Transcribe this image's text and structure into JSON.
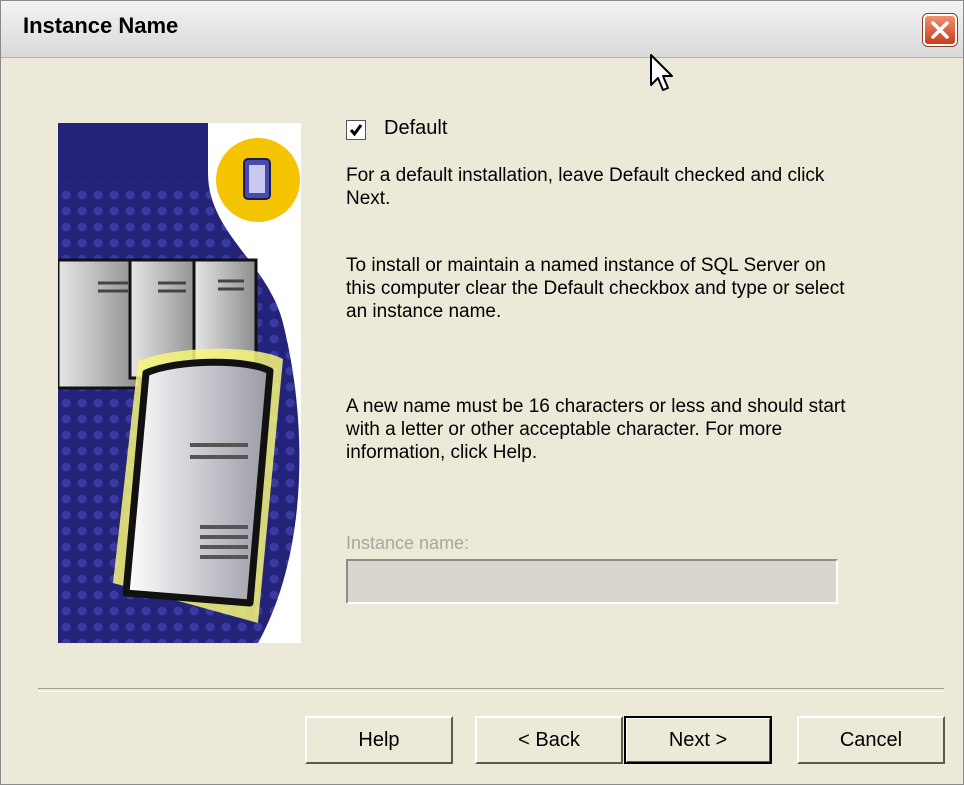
{
  "window": {
    "title": "Instance Name"
  },
  "default_checkbox": {
    "label": "Default",
    "checked": true
  },
  "paragraphs": [
    "For a default installation, leave Default checked and click Next.",
    "To install or maintain a named instance of SQL Server on this computer clear the Default checkbox and type or select an instance name.",
    "A new name must be 16 characters or less and should start with a letter or other acceptable character.  For more information, click Help."
  ],
  "instance_name": {
    "label": "Instance name:",
    "value": "",
    "enabled": false
  },
  "buttons": {
    "help": "Help",
    "back": "< Back",
    "next": "Next >",
    "cancel": "Cancel"
  },
  "icons": [
    "close-icon",
    "checkmark-icon",
    "server-illustration",
    "mouse-cursor-icon"
  ],
  "colors": {
    "close_button": "#d4502a",
    "art_blue": "#23237a",
    "art_yellow": "#f4c400",
    "disabled_text": "#a9a6a0"
  }
}
